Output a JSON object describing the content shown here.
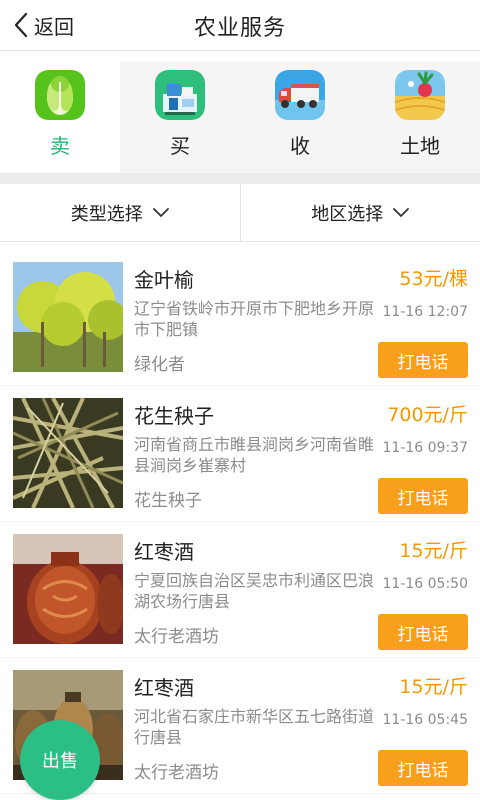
{
  "header": {
    "back_label": "返回",
    "title": "农业服务"
  },
  "categories": [
    {
      "label": "卖",
      "icon": "cabbage-icon",
      "active": true
    },
    {
      "label": "买",
      "icon": "shop-goods-icon",
      "active": false
    },
    {
      "label": "收",
      "icon": "truck-icon",
      "active": false
    },
    {
      "label": "土地",
      "icon": "field-radish-icon",
      "active": false
    }
  ],
  "filters": {
    "type_label": "类型选择",
    "region_label": "地区选择"
  },
  "listings": [
    {
      "name": "金叶榆",
      "price": "53元/棵",
      "address": "辽宁省铁岭市开原市下肥地乡开原市下肥镇",
      "time": "11-16 12:07",
      "seller": "绿化者",
      "call_label": "打电话"
    },
    {
      "name": "花生秧子",
      "price": "700元/斤",
      "address": "河南省商丘市睢县涧岗乡河南省睢县涧岗乡崔寨村",
      "time": "11-16 09:37",
      "seller": "花生秧子",
      "call_label": "打电话"
    },
    {
      "name": "红枣酒",
      "price": "15元/斤",
      "address": "宁夏回族自治区吴忠市利通区巴浪湖农场行唐县",
      "time": "11-16 05:50",
      "seller": "太行老酒坊",
      "call_label": "打电话"
    },
    {
      "name": "红枣酒",
      "price": "15元/斤",
      "address": "河北省石家庄市新华区五七路街道行唐县",
      "time": "11-16 05:45",
      "seller": "太行老酒坊",
      "call_label": "打电话"
    }
  ],
  "fab_label": "出售",
  "colors": {
    "accent_green": "#22b573",
    "price_orange": "#f39800",
    "button_orange": "#f8a01c",
    "fab_green": "#2bbf86"
  }
}
